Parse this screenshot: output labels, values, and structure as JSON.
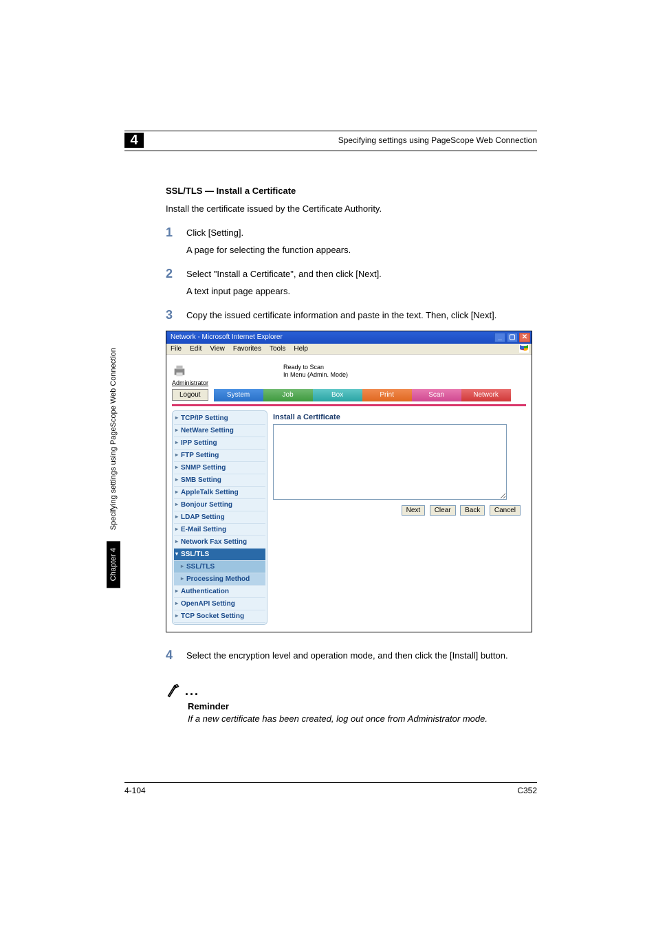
{
  "header": {
    "chapter_num": "4",
    "title": "Specifying settings using PageScope Web Connection"
  },
  "sidebar": {
    "label": "Specifying settings using PageScope Web Connection",
    "chapter": "Chapter 4"
  },
  "section_title": "SSL/TLS — Install a Certificate",
  "intro": "Install the certificate issued by the Certificate Authority.",
  "steps": [
    {
      "num": "1",
      "text": "Click [Setting].",
      "sub": "A page for selecting the function appears."
    },
    {
      "num": "2",
      "text": "Select \"Install a Certificate\", and then click [Next].",
      "sub": "A text input page appears."
    },
    {
      "num": "3",
      "text": "Copy the issued certificate information and paste in the text. Then, click [Next]."
    },
    {
      "num": "4",
      "text": "Select the encryption level and operation mode, and then click the [Install] button."
    }
  ],
  "screenshot": {
    "window_title": "Network - Microsoft Internet Explorer",
    "menubar": [
      "File",
      "Edit",
      "View",
      "Favorites",
      "Tools",
      "Help"
    ],
    "status": {
      "line1": "Ready to Scan",
      "line2": "In Menu (Admin. Mode)"
    },
    "admin": "Administrator",
    "logout": "Logout",
    "tabs": {
      "system": "System",
      "job": "Job",
      "box": "Box",
      "print": "Print",
      "scan": "Scan",
      "network": "Network"
    },
    "nav": [
      "TCP/IP Setting",
      "NetWare Setting",
      "IPP Setting",
      "FTP Setting",
      "SNMP Setting",
      "SMB Setting",
      "AppleTalk Setting",
      "Bonjour Setting",
      "LDAP Setting",
      "E-Mail Setting",
      "Network Fax Setting"
    ],
    "nav_selected": "SSL/TLS",
    "nav_sub": [
      "SSL/TLS",
      "Processing Method"
    ],
    "nav_after": [
      "Authentication",
      "OpenAPI Setting",
      "TCP Socket Setting"
    ],
    "panel_title": "Install a Certificate",
    "buttons": {
      "next": "Next",
      "clear": "Clear",
      "back": "Back",
      "cancel": "Cancel"
    }
  },
  "note": {
    "label": "Reminder",
    "text": "If a new certificate has been created, log out once from Administrator mode."
  },
  "footer": {
    "left": "4-104",
    "right": "C352"
  }
}
